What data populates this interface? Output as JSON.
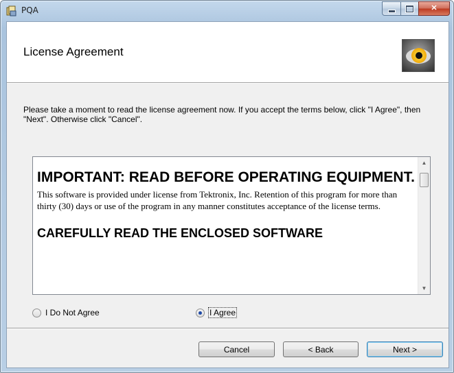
{
  "window": {
    "title": "PQA"
  },
  "banner": {
    "heading": "License Agreement"
  },
  "intro": "Please take a moment to read the license agreement now. If you accept the terms below, click \"I Agree\", then \"Next\". Otherwise click \"Cancel\".",
  "license": {
    "heading1": "IMPORTANT: READ BEFORE OPERATING EQUIPMENT.",
    "paragraph": "This software is provided under license from Tektronix, Inc. Retention of this program for more than thirty (30) days or use of the program in any manner constitutes acceptance of the license terms.",
    "heading2": "CAREFULLY READ THE ENCLOSED SOFTWARE"
  },
  "radios": {
    "disagree_label": "I Do Not Agree",
    "agree_label": "I Agree",
    "selected": "agree"
  },
  "buttons": {
    "cancel": "Cancel",
    "back": "< Back",
    "next": "Next >"
  }
}
